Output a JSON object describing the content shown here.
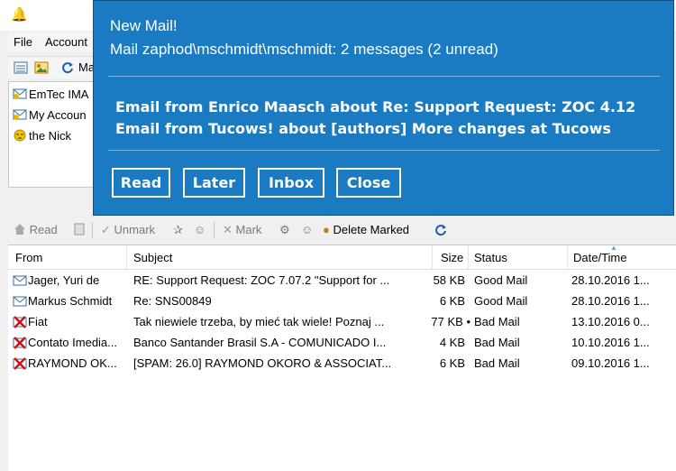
{
  "menu": {
    "file": "File",
    "accounts": "Account"
  },
  "toolbar_top": {
    "mail_label": "Ma"
  },
  "tree": [
    {
      "label": "EmTec IMA",
      "icon": "mailbox-icon"
    },
    {
      "label": "My Accoun",
      "icon": "mailbox-icon"
    },
    {
      "label": "the Nick",
      "icon": "sleeping-face-icon"
    }
  ],
  "toolbar": {
    "read": "Read",
    "unmark": "Unmark",
    "mark": "Mark",
    "delete_marked": "Delete Marked"
  },
  "columns": [
    "From",
    "Subject",
    "Size",
    "Status",
    "Date/Time"
  ],
  "messages": [
    {
      "from": "Jager, Yuri de",
      "subject": "RE: Support Request: ZOC 7.07.2 \"Support for ...",
      "size": "58 KB",
      "status": "Good Mail",
      "date": "28.10.2016 1...",
      "icon": "envelope-icon"
    },
    {
      "from": "Markus Schmidt",
      "subject": "Re: SNS00849",
      "size": "6 KB",
      "status": "Good Mail",
      "date": "28.10.2016 1...",
      "icon": "envelope-icon"
    },
    {
      "from": "Fiat",
      "subject": "Tak niewiele trzeba, by mieć tak wiele! Poznaj ...",
      "size": "77 KB •",
      "status": "Bad Mail",
      "date": "13.10.2016 0...",
      "icon": "bad-mail-icon"
    },
    {
      "from": "Contato Imedia...",
      "subject": "Banco Santander Brasil S.A - COMUNICADO I...",
      "size": "4 KB",
      "status": "Bad Mail",
      "date": "10.10.2016 1...",
      "icon": "bad-mail-icon"
    },
    {
      "from": "RAYMOND OK...",
      "subject": "[SPAM: 26.0] RAYMOND OKORO & ASSOCIAT...",
      "size": "6 KB",
      "status": "Bad Mail",
      "date": "09.10.2016 1...",
      "icon": "bad-mail-icon"
    }
  ],
  "popup": {
    "title": "New Mail!",
    "subtitle": "Mail zaphod\\mschmidt\\mschmidt: 2 messages (2 unread)",
    "lines": [
      "Email from Enrico Maasch about Re: Support Request: ZOC 4.12",
      "Email from Tucows! about [authors] More changes at Tucows"
    ],
    "buttons": {
      "read": "Read",
      "later": "Later",
      "inbox": "Inbox",
      "close": "Close"
    },
    "colors": {
      "background": "#1a7bc2",
      "text": "#ffffff"
    }
  }
}
